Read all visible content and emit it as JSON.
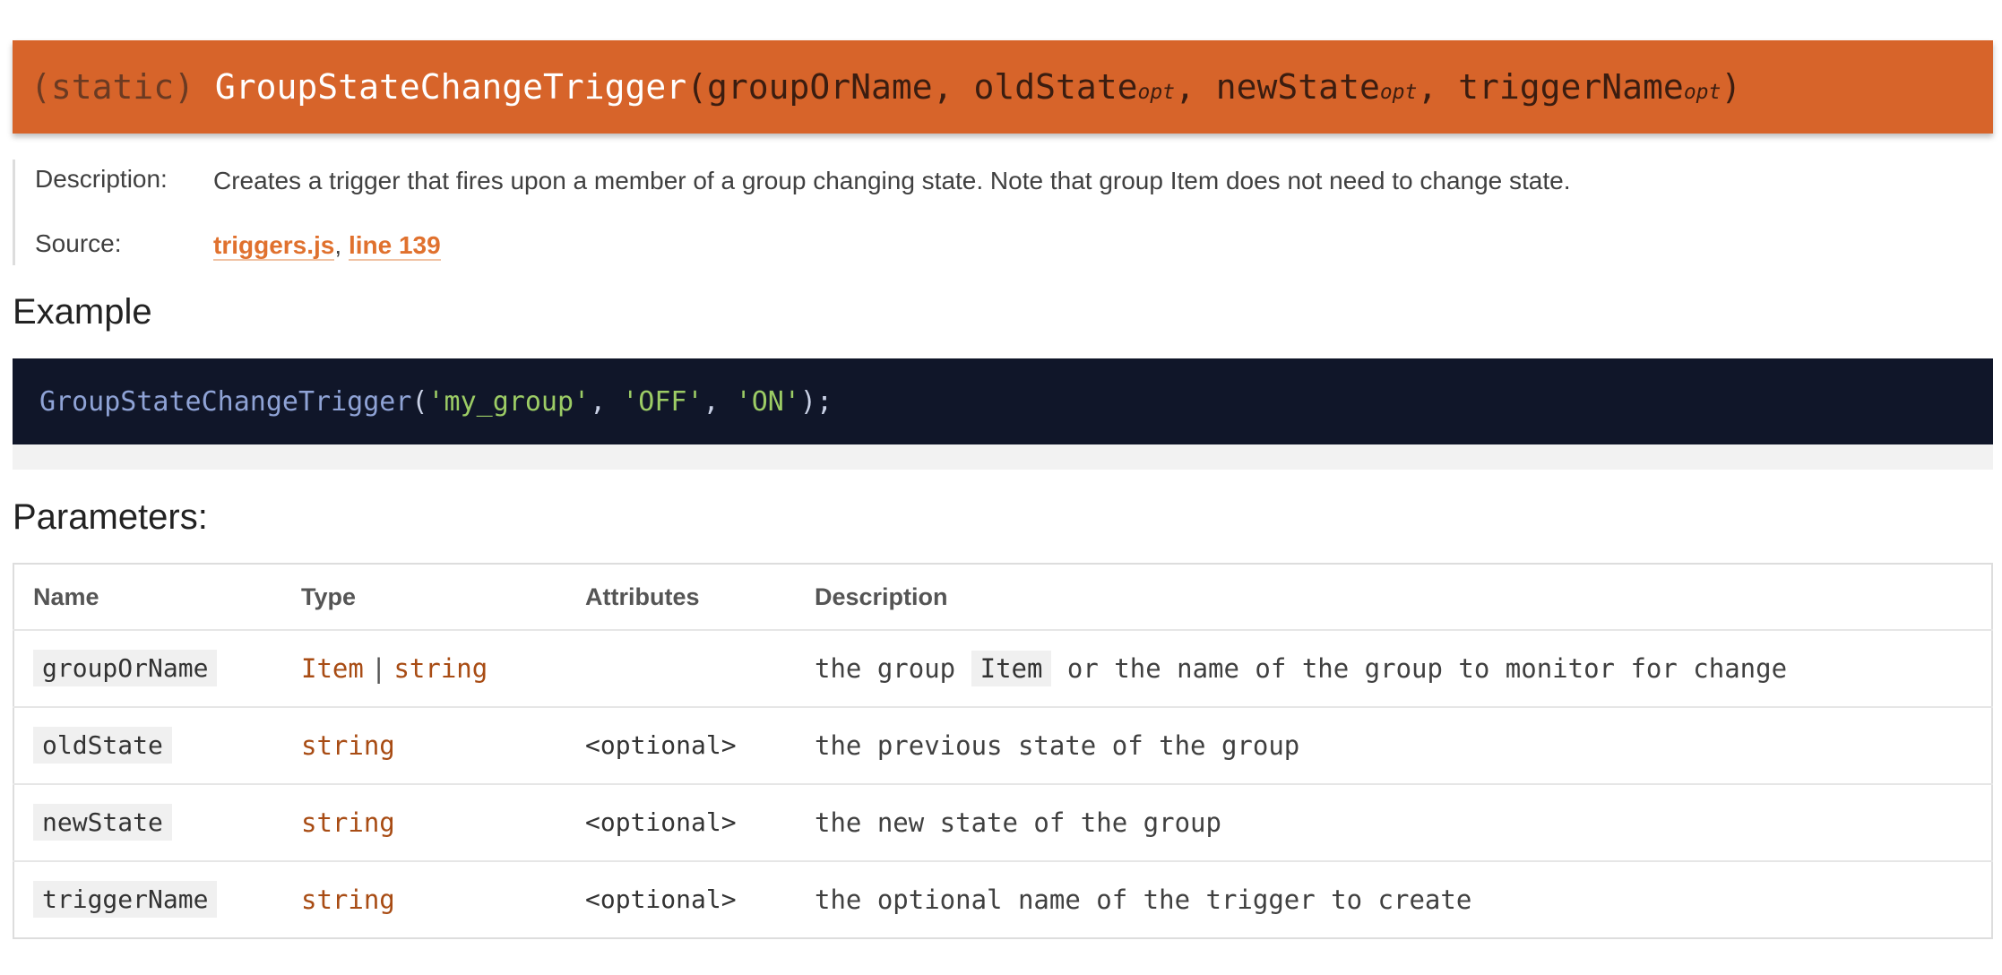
{
  "signature": {
    "prefix": "(static)",
    "name": "GroupStateChangeTrigger",
    "open_paren": "(",
    "params": [
      "groupOrName",
      "oldState",
      "newState",
      "triggerName"
    ],
    "opt_label": "opt",
    "separator": ", ",
    "close_paren": ")"
  },
  "details": {
    "description_label": "Description:",
    "description": "Creates a trigger that fires upon a member of a group changing state. Note that group Item does not need to change state.",
    "source_label": "Source:",
    "source_file": "triggers.js",
    "source_comma": ",",
    "source_line": "line 139"
  },
  "example": {
    "heading": "Example",
    "fn": "GroupStateChangeTrigger",
    "open": "(",
    "arg1": "'my_group'",
    "sep": ", ",
    "arg2": "'OFF'",
    "arg3": "'ON'",
    "close": ");"
  },
  "parameters": {
    "heading": "Parameters:",
    "columns": [
      "Name",
      "Type",
      "Attributes",
      "Description"
    ],
    "type_separator": "|",
    "rows": [
      {
        "name": "groupOrName",
        "type1": "Item",
        "type2": "string",
        "attributes": "",
        "desc_pre": "the group",
        "desc_code": "Item",
        "desc_post": "or the name of the group to monitor for change"
      },
      {
        "name": "oldState",
        "type1": "string",
        "attributes": "<optional>",
        "description": "the previous state of the group"
      },
      {
        "name": "newState",
        "type1": "string",
        "attributes": "<optional>",
        "description": "the new state of the group"
      },
      {
        "name": "triggerName",
        "type1": "string",
        "attributes": "<optional>",
        "description": "the optional name of the trigger to create"
      }
    ]
  }
}
